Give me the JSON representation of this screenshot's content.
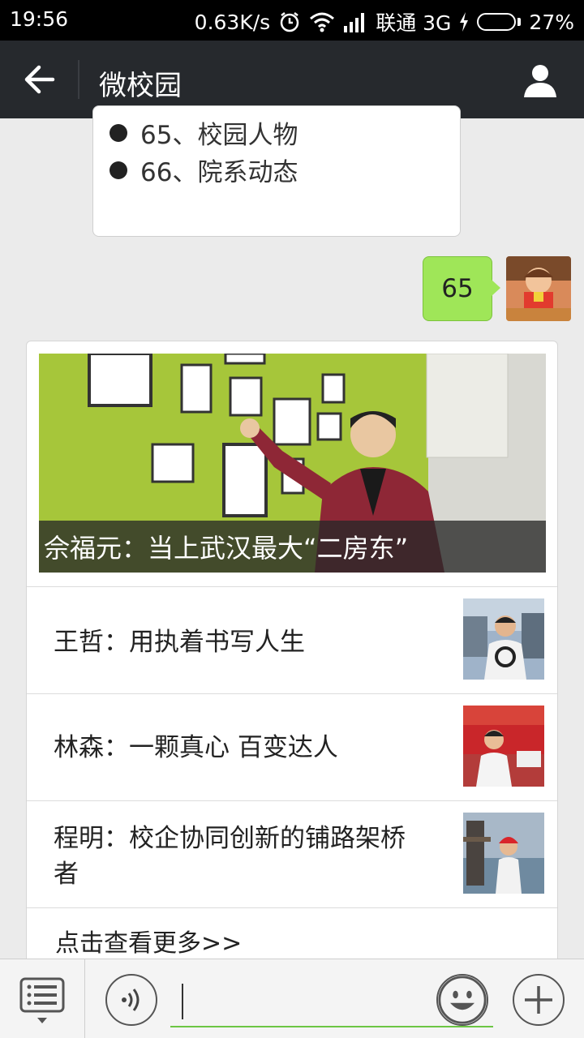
{
  "status_bar": {
    "time": "19:56",
    "net_speed": "0.63K/s",
    "carrier": "联通 3G",
    "battery": "27%",
    "battery_level": 0.27
  },
  "header": {
    "title": "微校园"
  },
  "menu_message": {
    "items": [
      "65、校园人物",
      "66、院系动态"
    ]
  },
  "my_message": {
    "text": "65"
  },
  "news": {
    "headline": "佘福元：当上武汉最大“二房东”",
    "items": [
      {
        "title": "王哲：用执着书写人生"
      },
      {
        "title": "林森：一颗真心 百变达人"
      },
      {
        "title": "程明：校企协同创新的铺路架桥者"
      }
    ],
    "more": "点击查看更多>>"
  },
  "colors": {
    "header_bg": "#26292d",
    "my_bubble": "#9fe658",
    "input_underline": "#6cc644"
  }
}
